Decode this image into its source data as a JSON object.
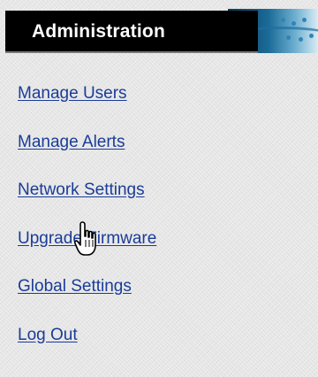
{
  "header": {
    "title": "Administration"
  },
  "menu": {
    "items": [
      {
        "label": "Manage Users"
      },
      {
        "label": "Manage Alerts"
      },
      {
        "label": "Network Settings"
      },
      {
        "label": "Upgrade Firmware"
      },
      {
        "label": "Global Settings"
      },
      {
        "label": "Log Out"
      }
    ]
  },
  "cursor": {
    "icon": "hand-pointer-icon"
  },
  "colors": {
    "link": "#1a3c98",
    "header_bg": "#000000",
    "page_bg": "#e6e6e6"
  }
}
